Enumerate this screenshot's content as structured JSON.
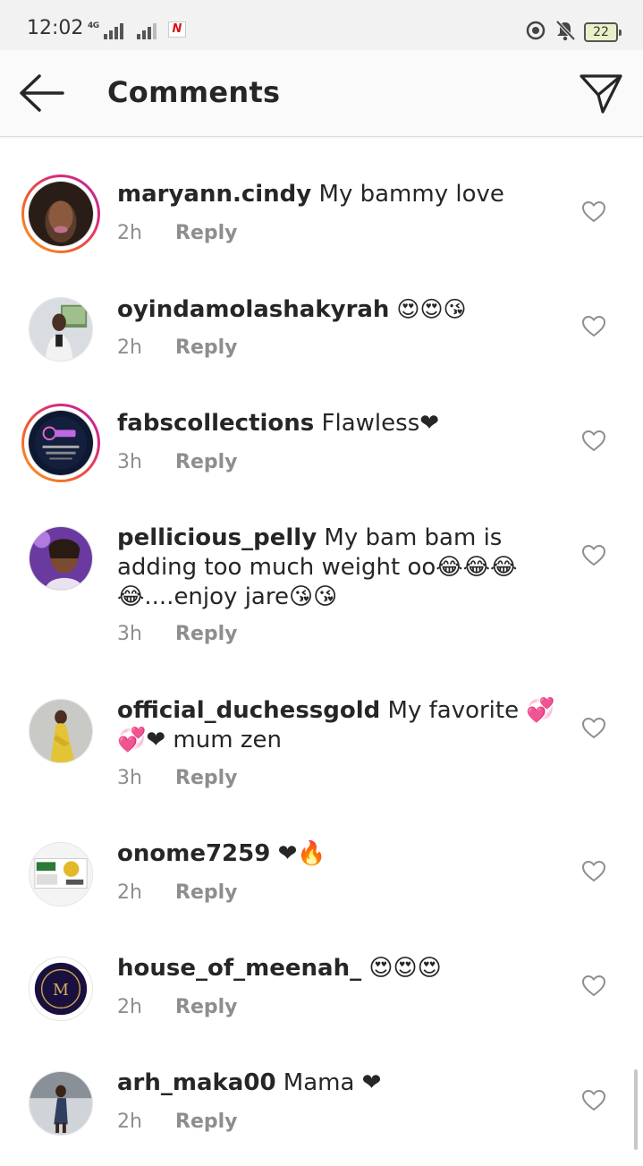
{
  "status_bar": {
    "time": "12:02",
    "network": "4G",
    "battery": "22"
  },
  "header": {
    "title": "Comments"
  },
  "comments": [
    {
      "username": "maryann.cindy",
      "text": " My bammy love",
      "time": "2h",
      "reply": "Reply",
      "story_ring": true
    },
    {
      "username": "oyindamolashakyrah",
      "text": " 😍😍😘",
      "time": "2h",
      "reply": "Reply",
      "story_ring": false
    },
    {
      "username": "fabscollections",
      "text": " Flawless❤",
      "time": "3h",
      "reply": "Reply",
      "story_ring": true
    },
    {
      "username": "pellicious_pelly",
      "text": " My bam bam is adding too much weight oo😂😂😂😂....enjoy jare😘😘",
      "time": "3h",
      "reply": "Reply",
      "story_ring": false
    },
    {
      "username": "official_duchessgold",
      "text": " My favorite 💞💞❤ mum zen",
      "time": "3h",
      "reply": "Reply",
      "story_ring": false
    },
    {
      "username": "onome7259",
      "text": " ❤🔥",
      "time": "2h",
      "reply": "Reply",
      "story_ring": false
    },
    {
      "username": "house_of_meenah_",
      "text": " 😍😍😍",
      "time": "2h",
      "reply": "Reply",
      "story_ring": false
    },
    {
      "username": "arh_maka00",
      "text": " Mama ❤",
      "time": "2h",
      "reply": "Reply",
      "story_ring": false
    }
  ],
  "icons": {
    "back": "arrow-left-icon",
    "send": "paper-plane-icon",
    "like": "heart-outline-icon"
  }
}
